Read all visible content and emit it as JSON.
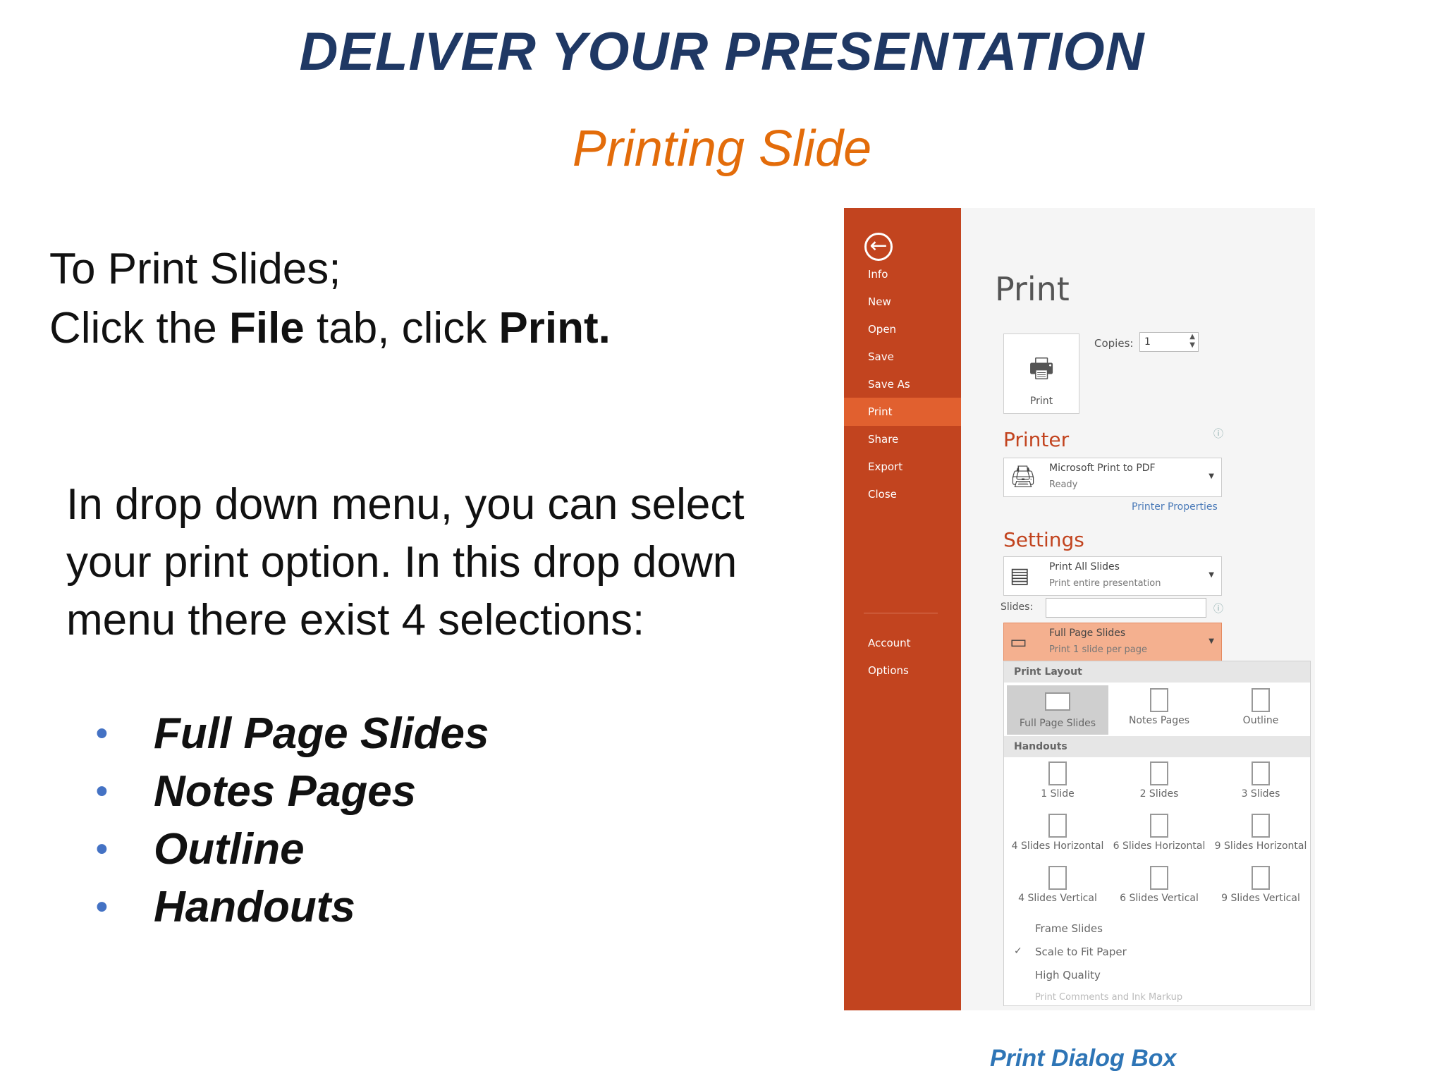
{
  "slide": {
    "title": "DELIVER YOUR PRESENTATION",
    "subtitle": "Printing Slide",
    "intro_line1": "To Print Slides;",
    "intro_line2_a": "Click the ",
    "intro_line2_b": "File",
    "intro_line2_c": " tab, click ",
    "intro_line2_d": "Print.",
    "body": "In drop down menu, you can select your print option. In this drop down menu there exist 4 selections:",
    "bullets": [
      "Full Page Slides",
      "Notes Pages",
      "Outline",
      "Handouts"
    ],
    "caption": "Print Dialog Box"
  },
  "dialog": {
    "sidebar": [
      "Info",
      "New",
      "Open",
      "Save",
      "Save As",
      "Print",
      "Share",
      "Export",
      "Close"
    ],
    "sidebar_bottom": [
      "Account",
      "Options"
    ],
    "active_item": "Print",
    "heading": "Print",
    "print_button": "Print",
    "copies_label": "Copies:",
    "copies_value": "1",
    "printer_section": "Printer",
    "printer_name": "Microsoft Print to PDF",
    "printer_status": "Ready",
    "printer_properties": "Printer Properties",
    "settings_section": "Settings",
    "range_title": "Print All Slides",
    "range_desc": "Print entire presentation",
    "slides_label": "Slides:",
    "layout_title": "Full Page Slides",
    "layout_desc": "Print 1 slide per page",
    "menu": {
      "print_layout_head": "Print Layout",
      "print_layout": [
        "Full Page Slides",
        "Notes Pages",
        "Outline"
      ],
      "handouts_head": "Handouts",
      "handouts": [
        "1 Slide",
        "2 Slides",
        "3 Slides",
        "4 Slides Horizontal",
        "6 Slides Horizontal",
        "9 Slides Horizontal",
        "4 Slides Vertical",
        "6 Slides Vertical",
        "9 Slides Vertical"
      ],
      "options": [
        "Frame Slides",
        "Scale to Fit Paper",
        "High Quality",
        "Print Comments and Ink Markup"
      ]
    }
  },
  "colors": {
    "title": "#1f3864",
    "subtitle": "#e36c0a",
    "sidebar": "#c2441f",
    "bullet": "#4472c4"
  }
}
